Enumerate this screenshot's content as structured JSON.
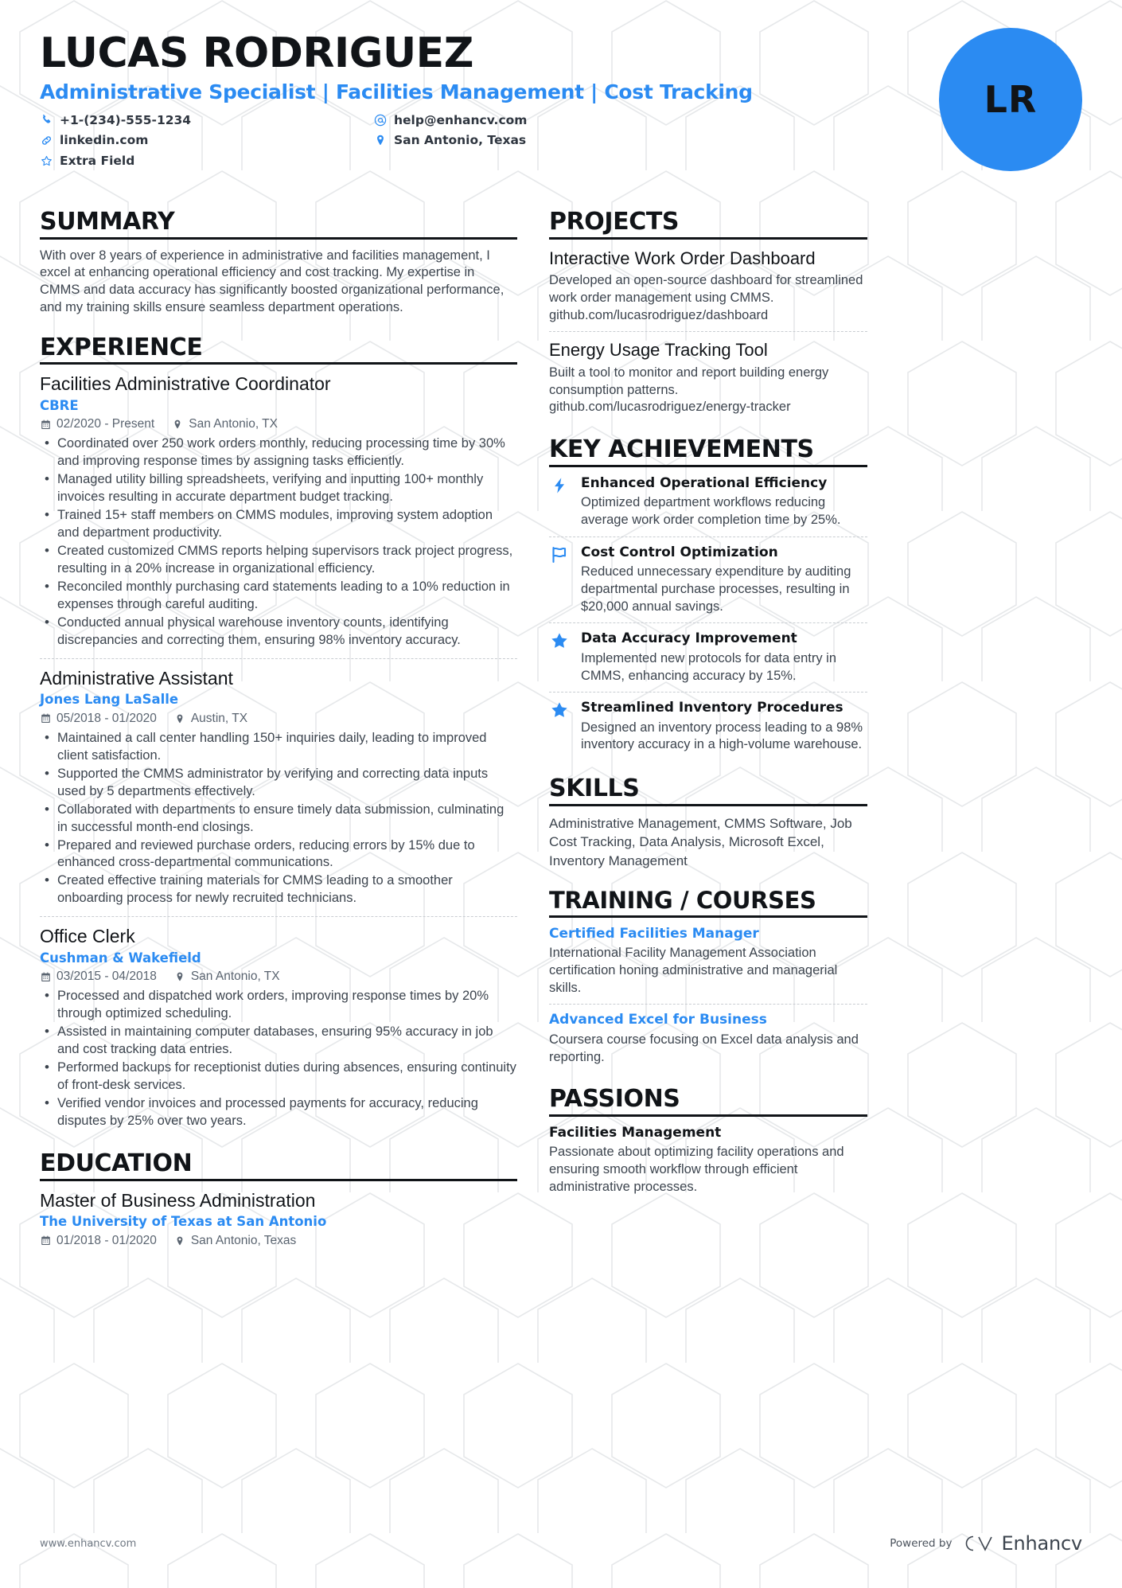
{
  "header": {
    "name": "LUCAS RODRIGUEZ",
    "headline": "Administrative Specialist | Facilities Management | Cost Tracking",
    "avatar_initials": "LR",
    "accent_color": "#2b8bf2",
    "contacts": [
      {
        "icon": "phone-icon",
        "value": "+1-(234)-555-1234"
      },
      {
        "icon": "email-icon",
        "value": "help@enhancv.com"
      },
      {
        "icon": "link-icon",
        "value": "linkedin.com"
      },
      {
        "icon": "location-icon",
        "value": "San Antonio, Texas"
      },
      {
        "icon": "star-outline-icon",
        "value": "Extra Field"
      }
    ]
  },
  "left": {
    "summary": {
      "title": "SUMMARY",
      "text": "With over 8 years of experience in administrative and facilities management, I excel at enhancing operational efficiency and cost tracking. My expertise in CMMS and data accuracy has significantly boosted organizational performance, and my training skills ensure seamless department operations."
    },
    "experience": {
      "title": "EXPERIENCE",
      "entries": [
        {
          "role": "Facilities Administrative Coordinator",
          "company": "CBRE",
          "dates": "02/2020 - Present",
          "location": "San Antonio, TX",
          "bullets": [
            "Coordinated over 250 work orders monthly, reducing processing time by 30% and improving response times by assigning tasks efficiently.",
            "Managed utility billing spreadsheets, verifying and inputting 100+ monthly invoices resulting in accurate department budget tracking.",
            "Trained 15+ staff members on CMMS modules, improving system adoption and department productivity.",
            "Created customized CMMS reports helping supervisors track project progress, resulting in a 20% increase in organizational efficiency.",
            "Reconciled monthly purchasing card statements leading to a 10% reduction in expenses through careful auditing.",
            "Conducted annual physical warehouse inventory counts, identifying discrepancies and correcting them, ensuring 98% inventory accuracy."
          ]
        },
        {
          "role": "Administrative Assistant",
          "company": "Jones Lang LaSalle",
          "dates": "05/2018 - 01/2020",
          "location": "Austin, TX",
          "bullets": [
            "Maintained a call center handling 150+ inquiries daily, leading to improved client satisfaction.",
            "Supported the CMMS administrator by verifying and correcting data inputs used by 5 departments effectively.",
            "Collaborated with departments to ensure timely data submission, culminating in successful month-end closings.",
            "Prepared and reviewed purchase orders, reducing errors by 15% due to enhanced cross-departmental communications.",
            "Created effective training materials for CMMS leading to a smoother onboarding process for newly recruited technicians."
          ]
        },
        {
          "role": "Office Clerk",
          "company": "Cushman & Wakefield",
          "dates": "03/2015 - 04/2018",
          "location": "San Antonio, TX",
          "bullets": [
            "Processed and dispatched work orders, improving response times by 20% through optimized scheduling.",
            "Assisted in maintaining computer databases, ensuring 95% accuracy in job and cost tracking data entries.",
            "Performed backups for receptionist duties during absences, ensuring continuity of front-desk services.",
            "Verified vendor invoices and processed payments for accuracy, reducing disputes by 25% over two years."
          ]
        }
      ]
    },
    "education": {
      "title": "EDUCATION",
      "entries": [
        {
          "degree": "Master of Business Administration",
          "school": "The University of Texas at San Antonio",
          "dates": "01/2018 - 01/2020",
          "location": "San Antonio, Texas"
        }
      ]
    }
  },
  "right": {
    "projects": {
      "title": "PROJECTS",
      "entries": [
        {
          "name": "Interactive Work Order Dashboard",
          "description": "Developed an open-source dashboard for streamlined work order management using CMMS. github.com/lucasrodriguez/dashboard"
        },
        {
          "name": "Energy Usage Tracking Tool",
          "description": "Built a tool to monitor and report building energy consumption patterns. github.com/lucasrodriguez/energy-tracker"
        }
      ]
    },
    "key_achievements": {
      "title": "KEY ACHIEVEMENTS",
      "entries": [
        {
          "icon": "lightning-bolt-icon",
          "title": "Enhanced Operational Efficiency",
          "description": "Optimized department workflows reducing average work order completion time by 25%."
        },
        {
          "icon": "flag-icon",
          "title": "Cost Control Optimization",
          "description": "Reduced unnecessary expenditure by auditing departmental purchase processes, resulting in $20,000 annual savings."
        },
        {
          "icon": "star-icon",
          "title": "Data Accuracy Improvement",
          "description": "Implemented new protocols for data entry in CMMS, enhancing accuracy by 15%."
        },
        {
          "icon": "star-icon",
          "title": "Streamlined Inventory Procedures",
          "description": "Designed an inventory process leading to a 98% inventory accuracy in a high-volume warehouse."
        }
      ]
    },
    "skills": {
      "title": "SKILLS",
      "text": "Administrative Management, CMMS Software, Job Cost Tracking, Data Analysis, Microsoft Excel, Inventory Management"
    },
    "training": {
      "title": "TRAINING / COURSES",
      "entries": [
        {
          "name": "Certified Facilities Manager",
          "description": "International Facility Management Association certification honing administrative and managerial skills."
        },
        {
          "name": "Advanced Excel for Business",
          "description": "Coursera course focusing on Excel data analysis and reporting."
        }
      ]
    },
    "passions": {
      "title": "PASSIONS",
      "entries": [
        {
          "name": "Facilities Management",
          "description": "Passionate about optimizing facility operations and ensuring smooth workflow through efficient administrative processes."
        }
      ]
    }
  },
  "footer": {
    "url": "www.enhancv.com",
    "powered_by": "Powered by",
    "brand": "Enhancv"
  }
}
